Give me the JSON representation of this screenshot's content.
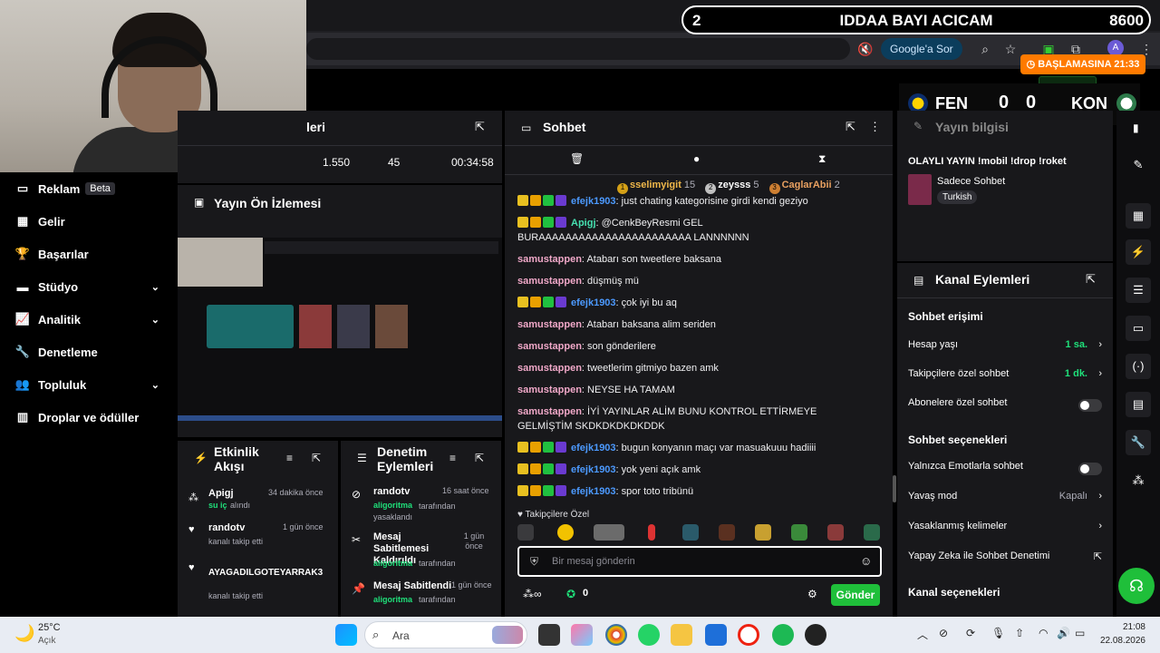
{
  "overlay": {
    "number": "2",
    "title": "IDDAA BAYI ACICAM",
    "viewers": "8600",
    "countdown": "BAŞLAMASINA 21:33"
  },
  "scoreboard": {
    "home_team": "FEN",
    "home_score": "0",
    "away_score": "0",
    "away_team": "KON"
  },
  "browser": {
    "google_ask": "Google'a Sor",
    "profile_initial": "A"
  },
  "left_nav": {
    "items": [
      {
        "label": "Reklam",
        "badge": "Beta",
        "icon": "ad-icon"
      },
      {
        "label": "Gelir",
        "icon": "revenue-icon"
      },
      {
        "label": "Başarılar",
        "icon": "trophy-icon"
      },
      {
        "label": "Stüdyo",
        "icon": "studio-icon"
      },
      {
        "label": "Analitik",
        "icon": "analytics-icon"
      },
      {
        "label": "Denetleme",
        "icon": "wrench-icon"
      },
      {
        "label": "Topluluk",
        "icon": "community-icon"
      },
      {
        "label": "Droplar ve ödüller",
        "icon": "drops-icon"
      }
    ]
  },
  "stats": {
    "title_fragment": "leri",
    "values": [
      "1.550",
      "45",
      "00:34:58"
    ]
  },
  "preview": {
    "title": "Yayın Ön İzlemesi"
  },
  "activity": {
    "title": "Etkinlik Akışı",
    "items": [
      {
        "user": "Apigj",
        "time": "34 dakika önce",
        "highlight": "su iç",
        "detail": "alındı"
      },
      {
        "user": "randotv",
        "time": "1 gün önce",
        "detail": "kanalı takip etti"
      },
      {
        "user": "AYAGADILGOTEYARRAK3",
        "time": "",
        "detail": "kanalı takip etti"
      }
    ]
  },
  "moderation": {
    "title": "Denetim Eylemleri",
    "items": [
      {
        "title": "randotv",
        "time": "16 saat önce",
        "actor": "aligoritma",
        "detail": "tarafından yasaklandı"
      },
      {
        "title": "Mesaj Sabitlemesi Kaldırıldı",
        "time": "1 gün önce",
        "actor": "aligoritma",
        "detail": "tarafından"
      },
      {
        "title": "Mesaj Sabitlendi",
        "time": "1 gün önce",
        "actor": "aligoritma",
        "detail": "tarafından"
      }
    ]
  },
  "chat": {
    "title": "Sohbet",
    "leaderboard": [
      {
        "rank": "1",
        "name": "sselimyigit",
        "count": "15"
      },
      {
        "rank": "2",
        "name": "zeysss",
        "count": "5"
      },
      {
        "rank": "3",
        "name": "CaglarAbii",
        "count": "2"
      }
    ],
    "messages": [
      {
        "user": "efejk1903",
        "color": "#4c9aff",
        "badges": true,
        "text": "just chating kategorisine girdi kendi geziyo"
      },
      {
        "user": "Apigj",
        "color": "#46e0b0",
        "badges": true,
        "text": "@CenkBeyResmi GEL BURAAAAAAAAAAAAAAAAAAAAAAA LANNNNNN"
      },
      {
        "user": "samustappen",
        "color": "#f0a8c8",
        "badges": false,
        "text": "Atabarı son tweetlere baksana"
      },
      {
        "user": "samustappen",
        "color": "#f0a8c8",
        "badges": false,
        "text": "düşmüş mü"
      },
      {
        "user": "efejk1903",
        "color": "#4c9aff",
        "badges": true,
        "text": "çok iyi bu aq"
      },
      {
        "user": "samustappen",
        "color": "#f0a8c8",
        "badges": false,
        "text": "Atabarı baksana alim seriden"
      },
      {
        "user": "samustappen",
        "color": "#f0a8c8",
        "badges": false,
        "text": "son gönderilere"
      },
      {
        "user": "samustappen",
        "color": "#f0a8c8",
        "badges": false,
        "text": "tweetlerim gitmiyo bazen amk"
      },
      {
        "user": "samustappen",
        "color": "#f0a8c8",
        "badges": false,
        "text": "NEYSE HA TAMAM"
      },
      {
        "user": "samustappen",
        "color": "#f0a8c8",
        "badges": false,
        "text": "İYİ YAYINLAR ALİM BUNU KONTROL ETTİRMEYE GELMİŞTİM SKDKDKDKDKDDK"
      },
      {
        "user": "efejk1903",
        "color": "#4c9aff",
        "badges": true,
        "text": "bugun konyanın maçı var masuakuuu hadiiii"
      },
      {
        "user": "efejk1903",
        "color": "#4c9aff",
        "badges": true,
        "text": "yok yeni açık amk"
      },
      {
        "user": "efejk1903",
        "color": "#4c9aff",
        "badges": true,
        "text": "spor toto tribünü"
      }
    ],
    "followers_only": "Takipçilere Özel",
    "input_placeholder": "Bir mesaj gönderin",
    "points": "0",
    "send_label": "Gönder"
  },
  "stream_info": {
    "title_fragment": "Yayın bilgisi",
    "stream_title": "OLAYLI YAYIN !mobil !drop !roket",
    "category": "Sadece Sohbet",
    "tag": "Turkish"
  },
  "channel_actions": {
    "title": "Kanal Eylemleri",
    "chat_access": "Sohbet erişimi",
    "account_age": {
      "label": "Hesap yaşı",
      "value": "1 sa."
    },
    "followers_chat": {
      "label": "Takipçilere özel sohbet",
      "value": "1 dk."
    },
    "subs_chat": {
      "label": "Abonelere özel sohbet"
    },
    "chat_options": "Sohbet seçenekleri",
    "emote_only": {
      "label": "Yalnızca Emotlarla sohbet"
    },
    "slow_mode": {
      "label": "Yavaş mod",
      "value": "Kapalı"
    },
    "banned_words": {
      "label": "Yasaklanmış kelimeler"
    },
    "ai_moderation": {
      "label": "Yapay Zeka ile Sohbet Denetimi"
    },
    "channel_options": "Kanal seçenekleri"
  },
  "taskbar": {
    "weather_temp": "25°C",
    "weather_desc": "Açık",
    "search_placeholder": "Ara",
    "time": "21:08",
    "date": "22.08.2026"
  },
  "colors": {
    "accent_green": "#1fbf3a",
    "countdown_orange": "#ff7a00",
    "panel_bg": "#18181b"
  }
}
